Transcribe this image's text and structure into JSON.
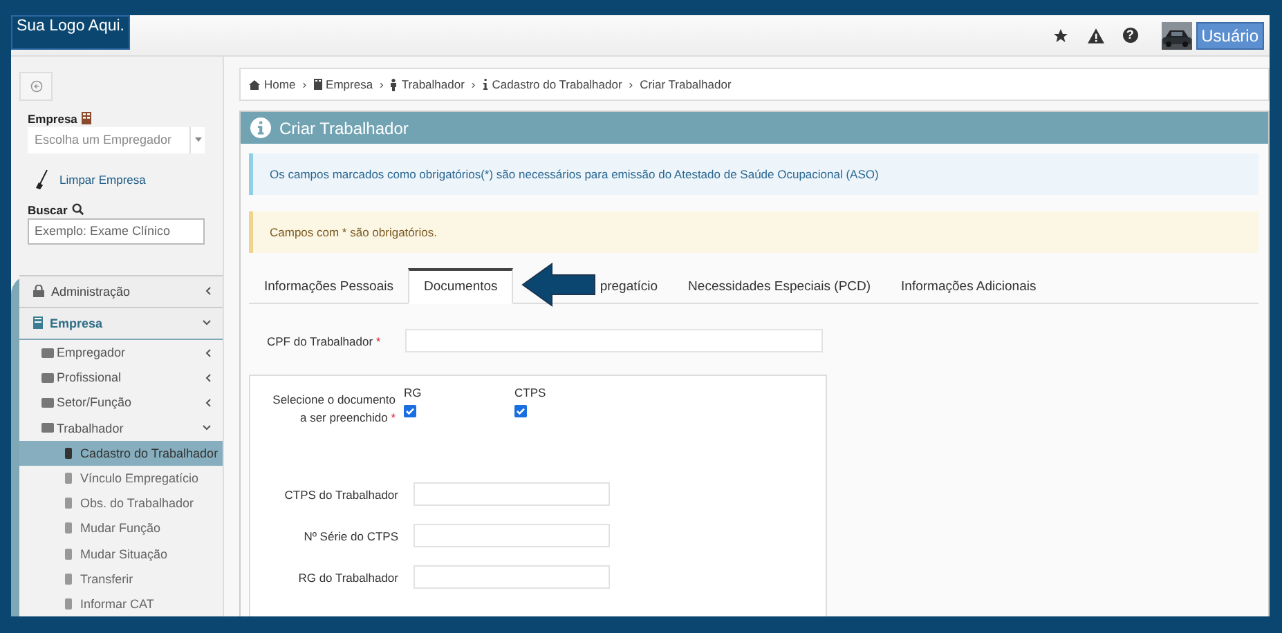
{
  "logo": "Sua Logo Aqui.",
  "topbar": {
    "user_button": "Usuário"
  },
  "sidebar": {
    "company_label": "Empresa",
    "company_select": {
      "placeholder": "Escolha um Empregador"
    },
    "clear_link": "Limpar Empresa",
    "search_label": "Buscar",
    "search_field": {
      "placeholder": "Exemplo: Exame Clínico"
    },
    "menu": [
      {
        "label": "Administração",
        "expanded": false
      },
      {
        "label": "Empresa",
        "expanded": true,
        "children": [
          {
            "label": "Empregador",
            "expanded": false
          },
          {
            "label": "Profissional",
            "expanded": false
          },
          {
            "label": "Setor/Função",
            "expanded": false
          },
          {
            "label": "Trabalhador",
            "expanded": true,
            "children": [
              {
                "label": "Cadastro do Trabalhador",
                "selected": true
              },
              {
                "label": "Vínculo Empregatício",
                "selected": false
              },
              {
                "label": "Obs. do Trabalhador",
                "selected": false
              },
              {
                "label": "Mudar Função",
                "selected": false
              },
              {
                "label": "Mudar Situação",
                "selected": false
              },
              {
                "label": "Transferir",
                "selected": false
              },
              {
                "label": "Informar CAT",
                "selected": false
              }
            ]
          }
        ]
      }
    ]
  },
  "breadcrumb": [
    "Home",
    "Empresa",
    "Trabalhador",
    "Cadastro do Trabalhador",
    "Criar Trabalhador"
  ],
  "breadcrumb_separator": "›",
  "help_glyph": "?",
  "panel": {
    "title": "Criar Trabalhador",
    "info_alert": "Os campos marcados como obrigatórios(*) são necessários para emissão do Atestado de Saúde Ocupacional (ASO)",
    "warning_alert": "Campos com * são obrigatórios.",
    "tabs": [
      {
        "label": "Informações Pessoais",
        "selected": false
      },
      {
        "label": "Documentos",
        "selected": true
      },
      {
        "label": "pregatício",
        "selected": false
      },
      {
        "label": "Necessidades Especiais (PCD)",
        "selected": false
      },
      {
        "label": "Informações Adicionais",
        "selected": false
      }
    ],
    "cpf_field": {
      "label": "CPF do Trabalhador",
      "required_mark": "*"
    },
    "document_select": {
      "label_lines": [
        "Selecione o documento",
        "a ser preenchido"
      ],
      "required_mark": "*",
      "options": [
        {
          "label": "RG",
          "checked": true
        },
        {
          "label": "CTPS",
          "checked": true
        }
      ]
    },
    "fields": [
      {
        "label": "CTPS do Trabalhador"
      },
      {
        "label": "Nº Série do CTPS"
      },
      {
        "label": "RG do Trabalhador"
      }
    ]
  }
}
